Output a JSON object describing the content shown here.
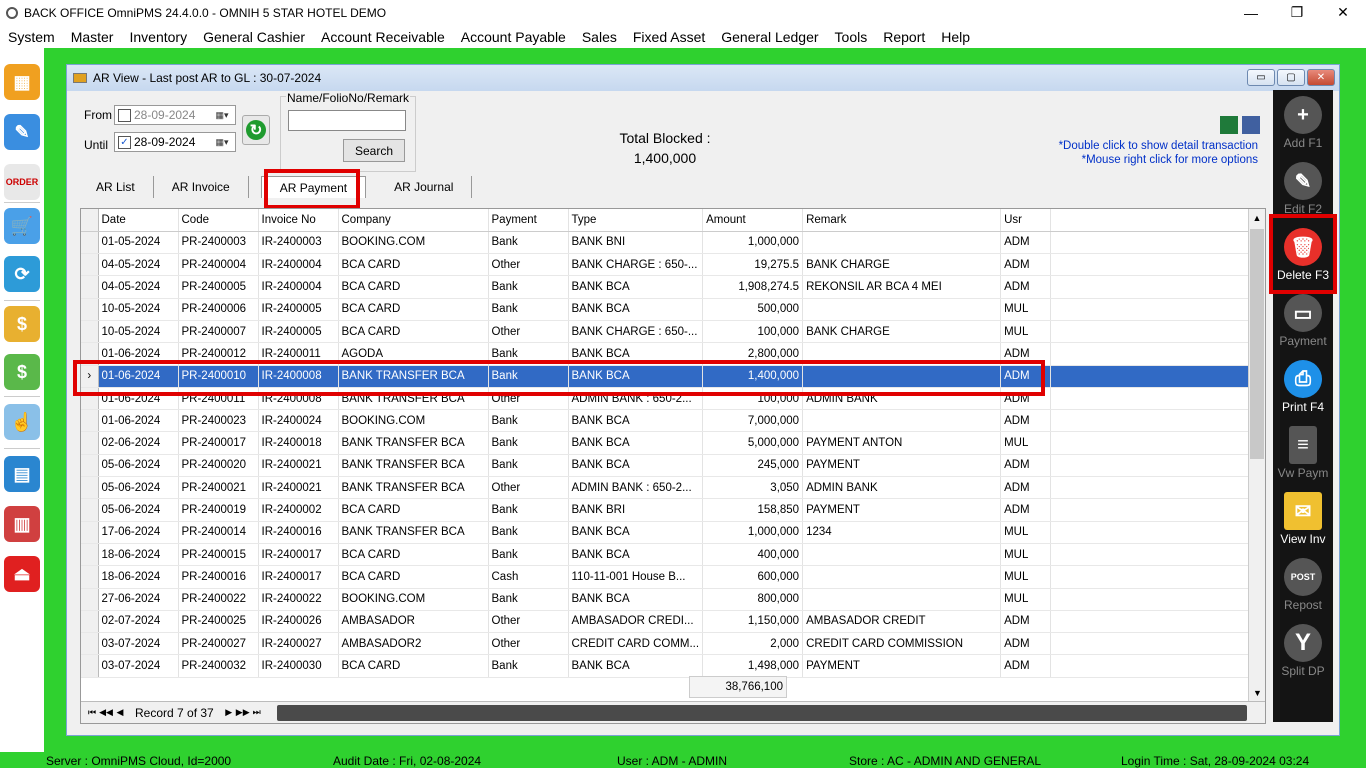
{
  "app": {
    "title": "BACK OFFICE OmniPMS 24.4.0.0 - OMNIH 5 STAR HOTEL DEMO",
    "win_min": "—",
    "win_max": "❐",
    "win_close": "✕"
  },
  "menu": [
    "System",
    "Master",
    "Inventory",
    "General Cashier",
    "Account Receivable",
    "Account Payable",
    "Sales",
    "Fixed Asset",
    "General Ledger",
    "Tools",
    "Report",
    "Help"
  ],
  "window": {
    "title": "AR View - Last post AR to GL : 30-07-2024"
  },
  "filters": {
    "from_label": "From",
    "from_value": "28-09-2024",
    "until_label": "Until",
    "until_value": "28-09-2024",
    "search_label": "Name/FolioNo/Remark",
    "search_value": "",
    "search_button": "Search"
  },
  "total": {
    "label": "Total Blocked :",
    "value": "1,400,000"
  },
  "hints": {
    "line1": "*Double click to show detail transaction",
    "line2": "*Mouse right click for more options"
  },
  "tabs": [
    "AR List",
    "AR Invoice",
    "AR Payment",
    "AR Journal"
  ],
  "active_tab": "AR Payment",
  "columns": [
    "Date",
    "Code",
    "Invoice No",
    "Company",
    "Payment",
    "Type",
    "Amount",
    "Remark",
    "Usr"
  ],
  "rows": [
    [
      "01-05-2024",
      "PR-2400003",
      "IR-2400003",
      "BOOKING.COM",
      "Bank",
      "BANK BNI",
      "1,000,000",
      "",
      "ADM"
    ],
    [
      "04-05-2024",
      "PR-2400004",
      "IR-2400004",
      "BCA CARD",
      "Other",
      "BANK CHARGE : 650-...",
      "19,275.5",
      "BANK CHARGE",
      "ADM"
    ],
    [
      "04-05-2024",
      "PR-2400005",
      "IR-2400004",
      "BCA CARD",
      "Bank",
      "BANK BCA",
      "1,908,274.5",
      "REKONSIL AR BCA 4 MEI",
      "ADM"
    ],
    [
      "10-05-2024",
      "PR-2400006",
      "IR-2400005",
      "BCA CARD",
      "Bank",
      "BANK BCA",
      "500,000",
      "",
      "MUL"
    ],
    [
      "10-05-2024",
      "PR-2400007",
      "IR-2400005",
      "BCA CARD",
      "Other",
      "BANK CHARGE : 650-...",
      "100,000",
      "BANK CHARGE",
      "MUL"
    ],
    [
      "01-06-2024",
      "PR-2400012",
      "IR-2400011",
      "AGODA",
      "Bank",
      "BANK BCA",
      "2,800,000",
      "",
      "ADM"
    ],
    [
      "01-06-2024",
      "PR-2400010",
      "IR-2400008",
      "BANK TRANSFER BCA",
      "Bank",
      "BANK BCA",
      "1,400,000",
      "",
      "ADM"
    ],
    [
      "01-06-2024",
      "PR-2400011",
      "IR-2400008",
      "BANK TRANSFER BCA",
      "Other",
      "ADMIN BANK : 650-2...",
      "100,000",
      "ADMIN BANK",
      "ADM"
    ],
    [
      "01-06-2024",
      "PR-2400023",
      "IR-2400024",
      "BOOKING.COM",
      "Bank",
      "BANK BCA",
      "7,000,000",
      "",
      "ADM"
    ],
    [
      "02-06-2024",
      "PR-2400017",
      "IR-2400018",
      "BANK TRANSFER BCA",
      "Bank",
      "BANK BCA",
      "5,000,000",
      "PAYMENT ANTON",
      "MUL"
    ],
    [
      "05-06-2024",
      "PR-2400020",
      "IR-2400021",
      "BANK TRANSFER BCA",
      "Bank",
      "BANK BCA",
      "245,000",
      "PAYMENT",
      "ADM"
    ],
    [
      "05-06-2024",
      "PR-2400021",
      "IR-2400021",
      "BANK TRANSFER BCA",
      "Other",
      "ADMIN BANK : 650-2...",
      "3,050",
      "ADMIN BANK",
      "ADM"
    ],
    [
      "05-06-2024",
      "PR-2400019",
      "IR-2400002",
      "BCA CARD",
      "Bank",
      "BANK BRI",
      "158,850",
      "PAYMENT",
      "ADM"
    ],
    [
      "17-06-2024",
      "PR-2400014",
      "IR-2400016",
      "BANK TRANSFER BCA",
      "Bank",
      "BANK BCA",
      "1,000,000",
      "1234",
      "MUL"
    ],
    [
      "18-06-2024",
      "PR-2400015",
      "IR-2400017",
      "BCA CARD",
      "Bank",
      "BANK BCA",
      "400,000",
      "",
      "MUL"
    ],
    [
      "18-06-2024",
      "PR-2400016",
      "IR-2400017",
      "BCA CARD",
      "Cash",
      "110-11-001 House B...",
      "600,000",
      "",
      "MUL"
    ],
    [
      "27-06-2024",
      "PR-2400022",
      "IR-2400022",
      "BOOKING.COM",
      "Bank",
      "BANK BCA",
      "800,000",
      "",
      "MUL"
    ],
    [
      "02-07-2024",
      "PR-2400025",
      "IR-2400026",
      "AMBASADOR",
      "Other",
      "AMBASADOR CREDI...",
      "1,150,000",
      "AMBASADOR CREDIT",
      "ADM"
    ],
    [
      "03-07-2024",
      "PR-2400027",
      "IR-2400027",
      "AMBASADOR2",
      "Other",
      "CREDIT CARD COMM...",
      "2,000",
      "CREDIT CARD COMMISSION",
      "ADM"
    ],
    [
      "03-07-2024",
      "PR-2400032",
      "IR-2400030",
      "BCA CARD",
      "Bank",
      "BANK BCA",
      "1,498,000",
      "PAYMENT",
      "ADM"
    ]
  ],
  "selected_row_index": 6,
  "amount_sum": "38,766,100",
  "navigator": {
    "record": "Record 7 of 37"
  },
  "right_toolbar": [
    {
      "label": "Add F1",
      "icon": "add-icon"
    },
    {
      "label": "Edit F2",
      "icon": "edit-icon"
    },
    {
      "label": "Delete F3",
      "icon": "trash-icon"
    },
    {
      "label": "Payment",
      "icon": "payment-icon"
    },
    {
      "label": "Print F4",
      "icon": "printer-icon"
    },
    {
      "label": "Vw Paym",
      "icon": "view-payment-icon"
    },
    {
      "label": "View Inv",
      "icon": "view-invoice-icon"
    },
    {
      "label": "Repost",
      "icon": "repost-icon"
    },
    {
      "label": "Split DP",
      "icon": "split-icon"
    }
  ],
  "status": {
    "server": "Server : OmniPMS Cloud, Id=2000",
    "audit": "Audit Date : Fri, 02-08-2024",
    "user": "User : ADM - ADMIN",
    "store": "Store : AC - ADMIN AND GENERAL",
    "login": "Login Time : Sat, 28-09-2024 03:24"
  },
  "colors": {
    "frame_green": "#2fd12f",
    "selection_blue": "#316ac5",
    "highlight_red": "#e00000",
    "toolbar_black": "#141414"
  }
}
